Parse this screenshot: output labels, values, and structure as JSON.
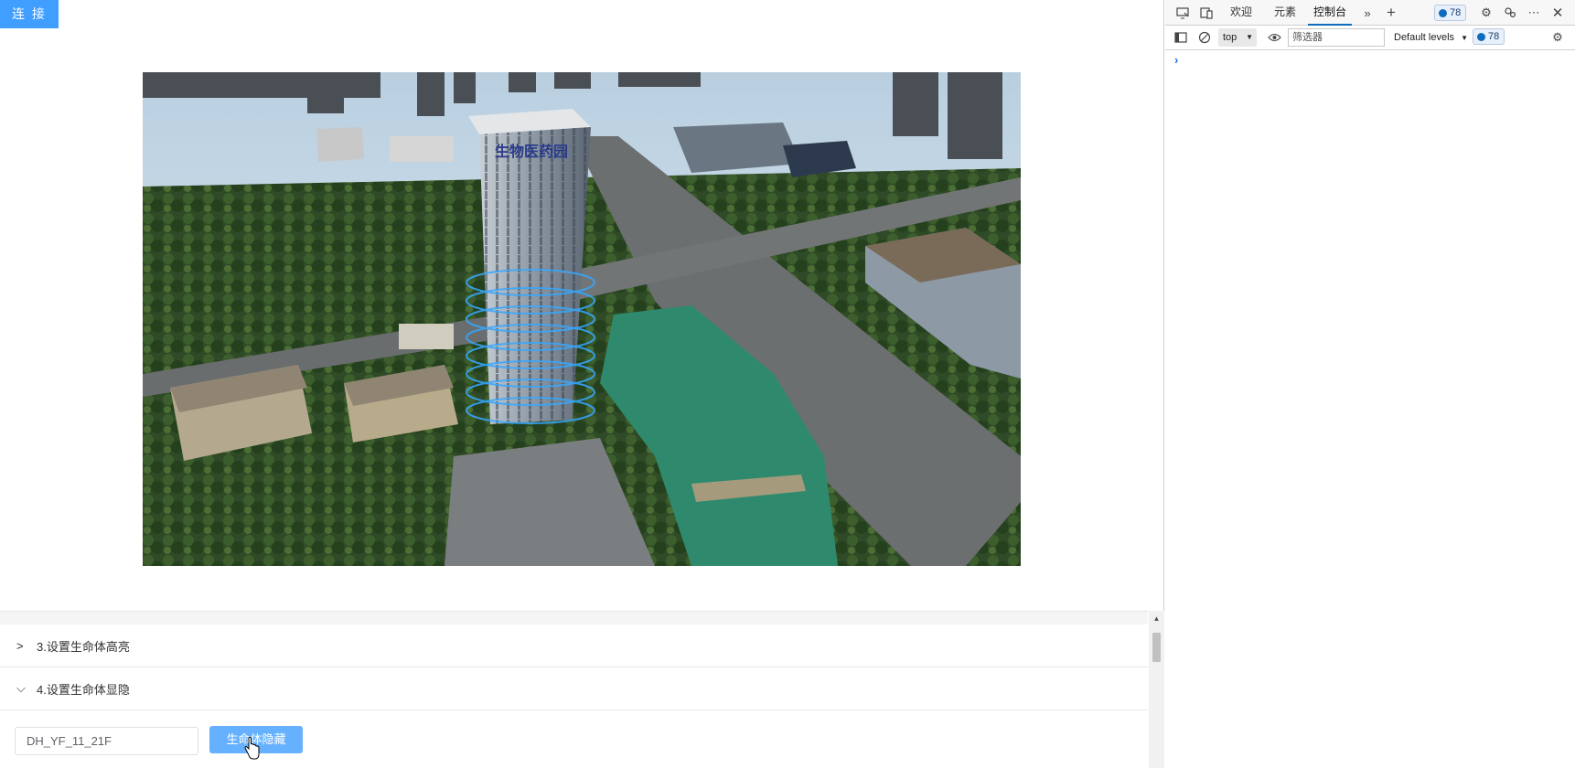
{
  "app": {
    "connect_label": "连 接",
    "panel": {
      "items": [
        {
          "label": "3.设置生命体高亮",
          "expanded": false
        },
        {
          "label": "4.设置生命体显隐",
          "expanded": true
        }
      ],
      "input_value": "DH_YF_11_21F",
      "hide_button_label": "生命体隐藏"
    },
    "scene": {
      "building_sign": "生物医药园"
    }
  },
  "devtools": {
    "tabs": [
      {
        "label": "欢迎",
        "active": false
      },
      {
        "label": "元素",
        "active": false
      },
      {
        "label": "控制台",
        "active": true
      }
    ],
    "issues_count": "78",
    "context": "top",
    "filter_placeholder": "筛选器",
    "levels_label": "Default levels",
    "toolbar_issues_count": "78",
    "prompt_symbol": "›"
  },
  "colors": {
    "primary": "#409eff",
    "primary_light": "#66b1ff",
    "devtools_accent": "#0f6cbd"
  }
}
